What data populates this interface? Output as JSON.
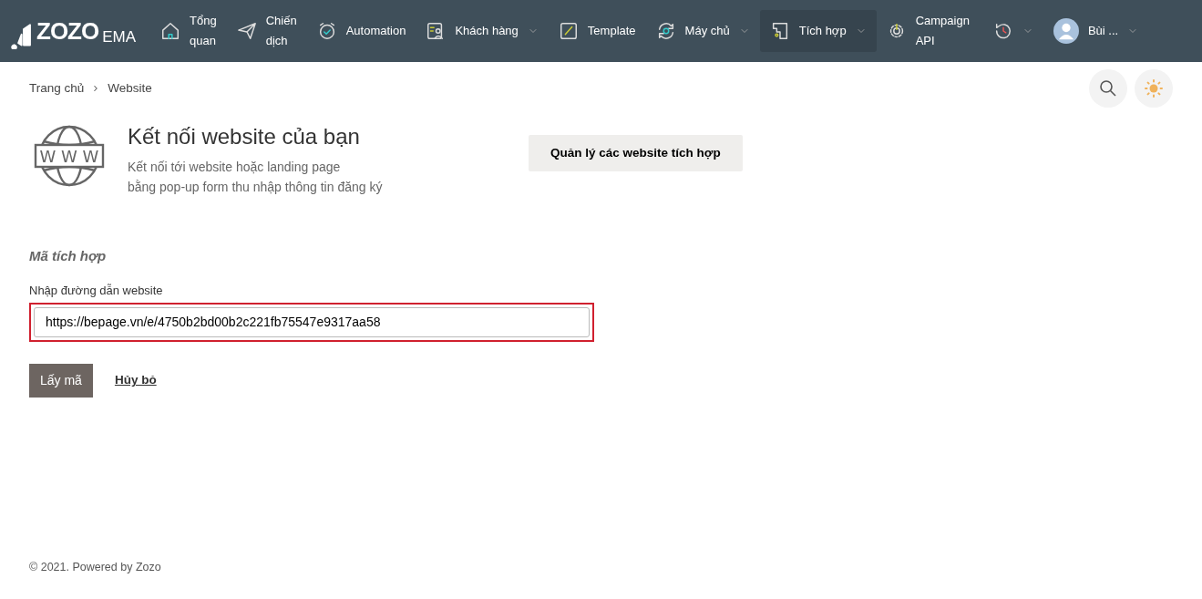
{
  "brand": {
    "logo": "ZOZO",
    "suffix": "EMA"
  },
  "nav": [
    {
      "kind": "home",
      "label": "Tổng\nquan",
      "dropdown": false,
      "selected": false
    },
    {
      "kind": "send",
      "label": "Chiến\ndịch",
      "dropdown": false,
      "selected": false
    },
    {
      "kind": "clock",
      "label": "Automation",
      "dropdown": false,
      "selected": false
    },
    {
      "kind": "contacts",
      "label": "Khách hàng",
      "dropdown": true,
      "selected": false
    },
    {
      "kind": "template",
      "label": "Template",
      "dropdown": false,
      "selected": false
    },
    {
      "kind": "sync",
      "label": "Máy chủ",
      "dropdown": true,
      "selected": false
    },
    {
      "kind": "plug",
      "label": "Tích hợp",
      "dropdown": true,
      "selected": true
    },
    {
      "kind": "gear",
      "label": "Campaign\nAPI",
      "dropdown": false,
      "selected": false
    }
  ],
  "user": {
    "name": "Bùi ..."
  },
  "breadcrumb": [
    {
      "label": "Trang chủ"
    },
    {
      "label": "Website"
    }
  ],
  "header": {
    "globe_label": "W W W",
    "title": "Kết nối website của bạn",
    "subtitle": "Kết nối tới website hoặc landing page\nbằng pop-up form thu nhập thông tin đăng ký",
    "manage_button": "Quản lý các website tích hợp"
  },
  "form": {
    "section_title": "Mã tích hợp",
    "field_label": "Nhập đường dẫn website",
    "value": "https://bepage.vn/e/4750b2bd00b2c221fb75547e9317aa58",
    "highlighted": true,
    "submit": "Lấy mã",
    "cancel": "Hủy bỏ"
  },
  "footer": "© 2021. Powered by Zozo"
}
